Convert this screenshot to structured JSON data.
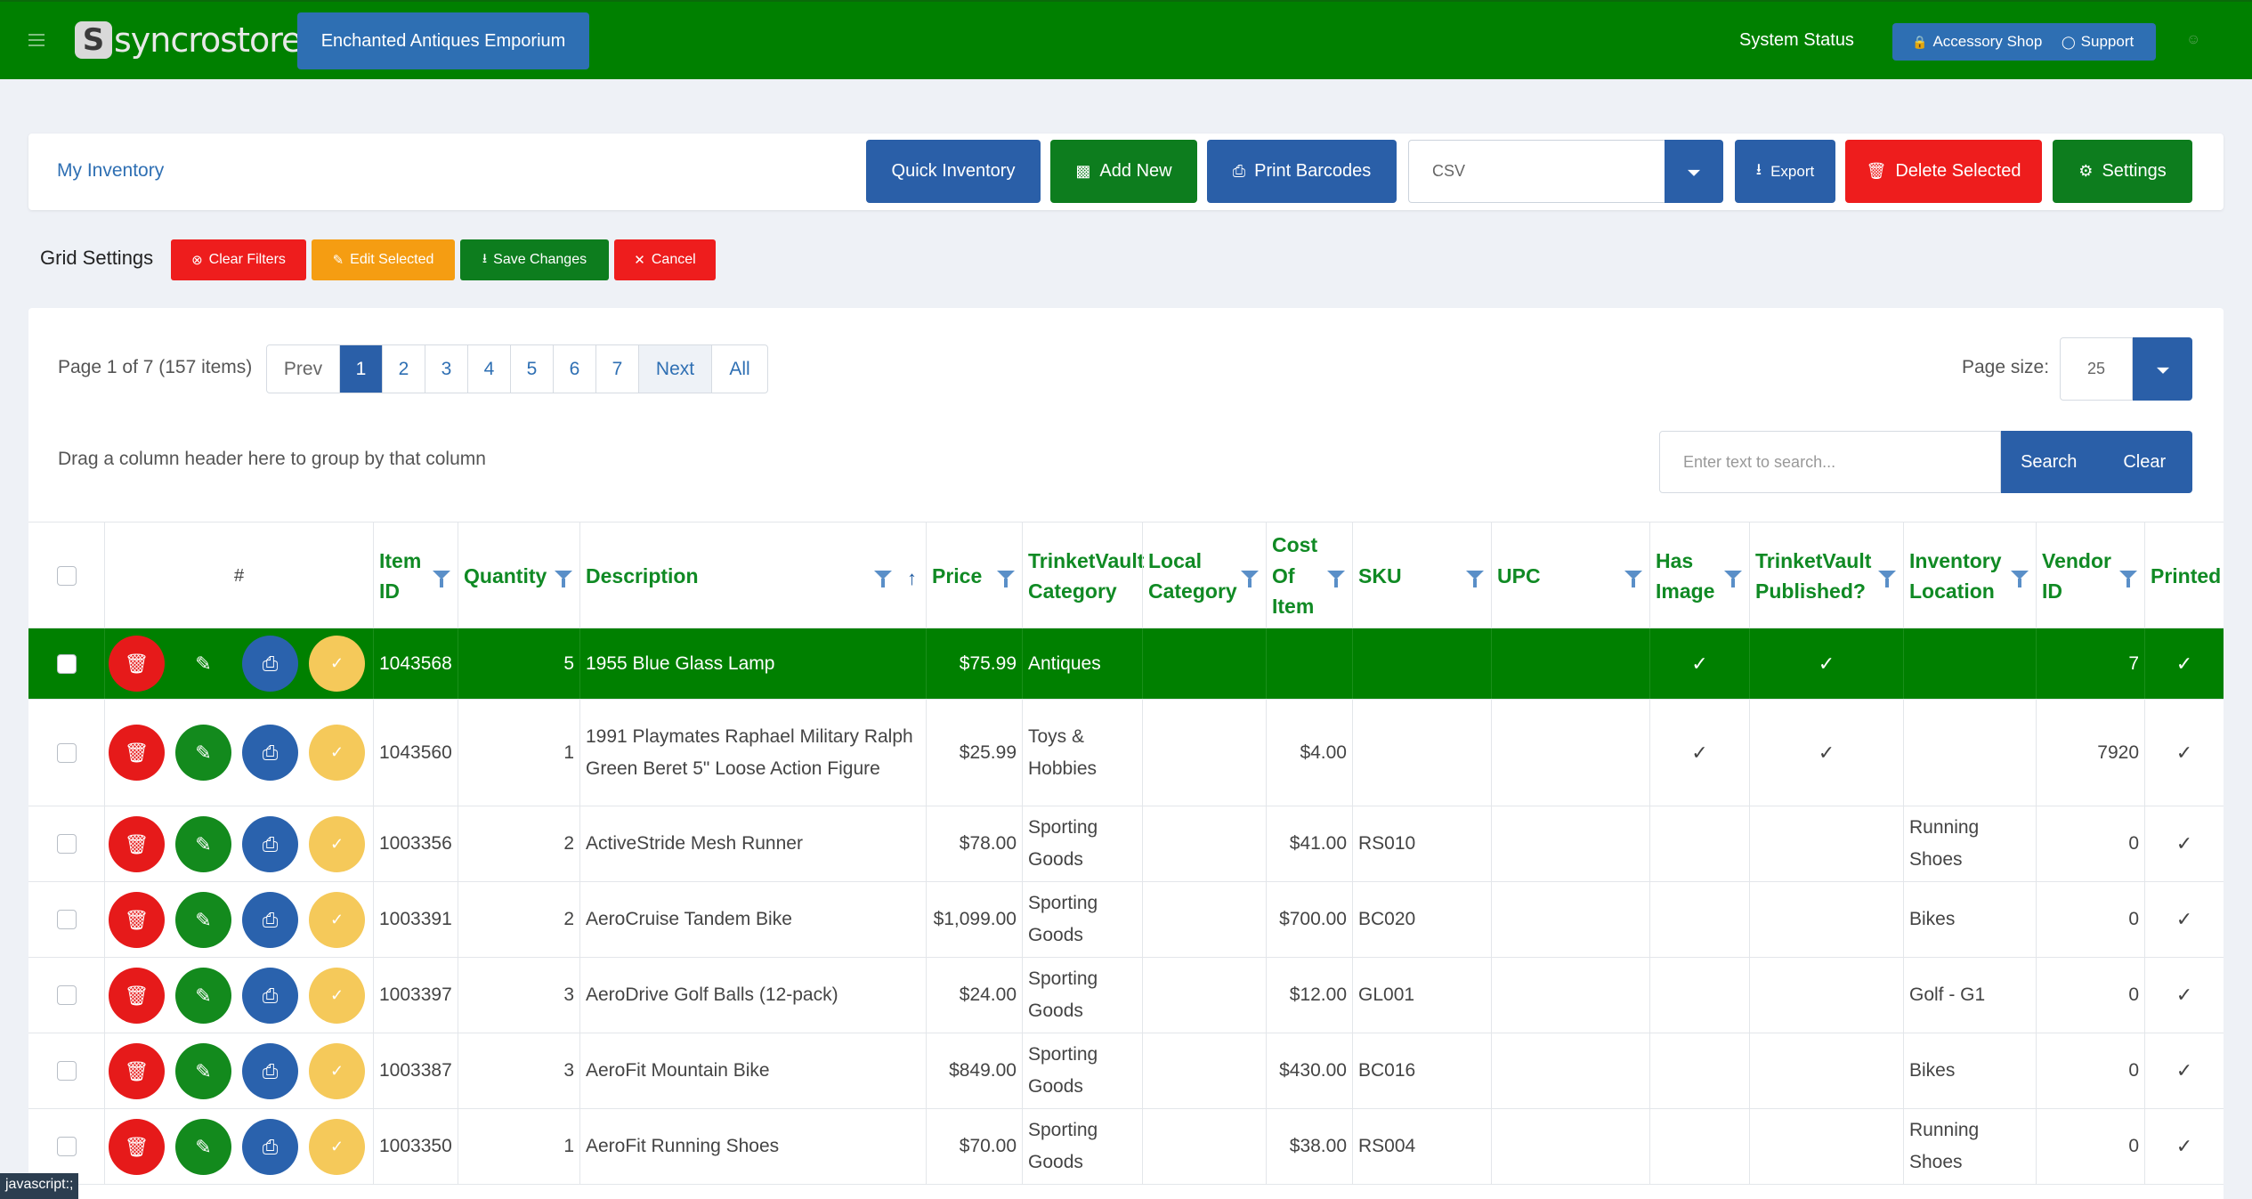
{
  "topbar": {
    "logo_text": "syncrostore",
    "store_name": "Enchanted Antiques Emporium",
    "system_status": "System Status",
    "accessory_shop": "Accessory Shop",
    "support": "Support"
  },
  "toolbar": {
    "breadcrumb": "My Inventory",
    "quick_inventory": "Quick Inventory",
    "add_new": "Add New",
    "print_barcodes": "Print Barcodes",
    "export_format": "CSV",
    "export": "Export",
    "delete_selected": "Delete Selected",
    "settings": "Settings"
  },
  "grid_settings": {
    "label": "Grid Settings",
    "clear_filters": "Clear Filters",
    "edit_selected": "Edit Selected",
    "save_changes": "Save Changes",
    "cancel": "Cancel"
  },
  "pager": {
    "info": "Page 1 of 7 (157 items)",
    "prev": "Prev",
    "pages": [
      "1",
      "2",
      "3",
      "4",
      "5",
      "6",
      "7"
    ],
    "active_page": "1",
    "next": "Next",
    "all": "All",
    "page_size_label": "Page size:",
    "page_size": "25"
  },
  "grouping": {
    "hint": "Drag a column header here to group by that column"
  },
  "search": {
    "placeholder": "Enter text to search...",
    "search": "Search",
    "clear": "Clear"
  },
  "columns": {
    "hash": "#",
    "item_id": "Item ID",
    "quantity": "Quantity",
    "description": "Description",
    "price": "Price",
    "tv_category": "TrinketVault Category",
    "local_category": "Local Category",
    "cost": "Cost Of Item",
    "sku": "SKU",
    "upc": "UPC",
    "has_image": "Has Image",
    "tv_published": "TrinketVault Published?",
    "inventory_location": "Inventory Location",
    "vendor_id": "Vendor ID",
    "printed": "Printed"
  },
  "rows": [
    {
      "item_id": "1043568",
      "quantity": "5",
      "description": "1955 Blue Glass Lamp",
      "price": "$75.99",
      "tv_category": "Antiques",
      "local_category": "",
      "cost": "",
      "sku": "",
      "upc": "",
      "has_image": "✓",
      "tv_published": "✓",
      "location": "",
      "vendor_id": "7",
      "printed": "✓"
    },
    {
      "item_id": "1043560",
      "quantity": "1",
      "description": "1991 Playmates Raphael Military Ralph Green Beret 5\" Loose Action Figure",
      "price": "$25.99",
      "tv_category": "Toys & Hobbies",
      "local_category": "",
      "cost": "$4.00",
      "sku": "",
      "upc": "",
      "has_image": "✓",
      "tv_published": "✓",
      "location": "",
      "vendor_id": "7920",
      "printed": "✓"
    },
    {
      "item_id": "1003356",
      "quantity": "2",
      "description": "ActiveStride Mesh Runner",
      "price": "$78.00",
      "tv_category": "Sporting Goods",
      "local_category": "",
      "cost": "$41.00",
      "sku": "RS010",
      "upc": "",
      "has_image": "",
      "tv_published": "",
      "location": "Running Shoes",
      "vendor_id": "0",
      "printed": "✓"
    },
    {
      "item_id": "1003391",
      "quantity": "2",
      "description": "AeroCruise Tandem Bike",
      "price": "$1,099.00",
      "tv_category": "Sporting Goods",
      "local_category": "",
      "cost": "$700.00",
      "sku": "BC020",
      "upc": "",
      "has_image": "",
      "tv_published": "",
      "location": "Bikes",
      "vendor_id": "0",
      "printed": "✓"
    },
    {
      "item_id": "1003397",
      "quantity": "3",
      "description": "AeroDrive Golf Balls (12-pack)",
      "price": "$24.00",
      "tv_category": "Sporting Goods",
      "local_category": "",
      "cost": "$12.00",
      "sku": "GL001",
      "upc": "",
      "has_image": "",
      "tv_published": "",
      "location": "Golf - G1",
      "vendor_id": "0",
      "printed": "✓"
    },
    {
      "item_id": "1003387",
      "quantity": "3",
      "description": "AeroFit Mountain Bike",
      "price": "$849.00",
      "tv_category": "Sporting Goods",
      "local_category": "",
      "cost": "$430.00",
      "sku": "BC016",
      "upc": "",
      "has_image": "",
      "tv_published": "",
      "location": "Bikes",
      "vendor_id": "0",
      "printed": "✓"
    },
    {
      "item_id": "1003350",
      "quantity": "1",
      "description": "AeroFit Running Shoes",
      "price": "$70.00",
      "tv_category": "Sporting Goods",
      "local_category": "",
      "cost": "$38.00",
      "sku": "RS004",
      "upc": "",
      "has_image": "",
      "tv_published": "",
      "location": "Running Shoes",
      "vendor_id": "0",
      "printed": "✓"
    }
  ],
  "status_bar": {
    "text": "javascript:;"
  },
  "colors": {
    "topbar": "#008000",
    "primary": "#2a5fa8",
    "success": "#0d7d1e",
    "danger": "#ee1d1d",
    "warning": "#f59d12",
    "header_text": "#108a24"
  },
  "icons": {
    "menu": "hamburger-icon",
    "lock": "lock-icon",
    "support": "headset-icon",
    "user": "user-icon",
    "add": "plus-square-icon",
    "print": "printer-icon",
    "export": "download-icon",
    "delete": "trash-icon",
    "settings": "gear-icon",
    "clear_filters": "x-circle-icon",
    "edit": "pencil-square-icon",
    "save": "save-icon",
    "cancel": "x-icon",
    "filter": "filter-icon",
    "sort": "sort-up-icon",
    "row_delete": "trash-icon",
    "row_edit": "pencil-icon",
    "row_print": "printer-icon",
    "row_confirm": "check-icon"
  }
}
